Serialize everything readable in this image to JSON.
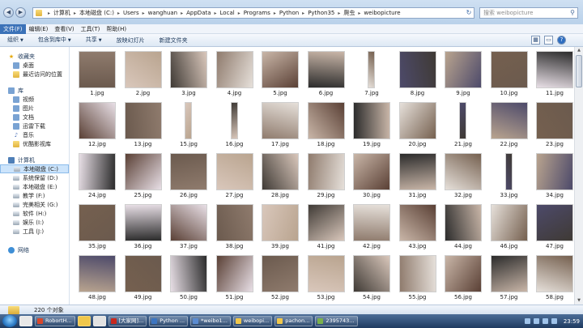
{
  "address": {
    "segments": [
      "计算机",
      "本地磁盘 (C:)",
      "Users",
      "wanghuan",
      "AppData",
      "Local",
      "Programs",
      "Python",
      "Python35",
      "爬虫",
      "weibopicture"
    ],
    "search_placeholder": "搜索 weibopicture"
  },
  "menu": [
    "文件(F)",
    "编辑(E)",
    "查看(V)",
    "工具(T)",
    "帮助(H)"
  ],
  "toolbar": [
    "组织",
    "包含到库中",
    "共享",
    "放映幻灯片",
    "新建文件夹"
  ],
  "nav": {
    "favorites": {
      "title": "收藏夹",
      "items": [
        "桌面",
        "最近访问的位置"
      ]
    },
    "library": {
      "title": "库",
      "items": [
        "视频",
        "图片",
        "文档",
        "迅雷下载",
        "音乐",
        "优酷影视库"
      ]
    },
    "computer": {
      "title": "计算机",
      "items": [
        "本地磁盘 (C:)",
        "系统保留 (D:)",
        "本地磁盘 (E:)",
        "教学 (F:)",
        "完美相关 (G:)",
        "软件 (H:)",
        "娱乐 (I:)",
        "工具 (J:)"
      ]
    },
    "network": {
      "title": "网络"
    }
  },
  "files": [
    "1.jpg",
    "2.jpg",
    "3.jpg",
    "4.jpg",
    "5.jpg",
    "6.jpg",
    "7.jpg",
    "8.jpg",
    "9.jpg",
    "10.jpg",
    "11.jpg",
    "12.jpg",
    "13.jpg",
    "15.jpg",
    "16.jpg",
    "17.jpg",
    "18.jpg",
    "19.jpg",
    "20.jpg",
    "21.jpg",
    "22.jpg",
    "23.jpg",
    "24.jpg",
    "25.jpg",
    "26.jpg",
    "27.jpg",
    "28.jpg",
    "29.jpg",
    "30.jpg",
    "31.jpg",
    "32.jpg",
    "33.jpg",
    "34.jpg",
    "35.jpg",
    "36.jpg",
    "37.jpg",
    "38.jpg",
    "39.jpg",
    "41.jpg",
    "42.jpg",
    "43.jpg",
    "44.jpg",
    "46.jpg",
    "47.jpg",
    "48.jpg",
    "49.jpg",
    "50.jpg",
    "51.jpg",
    "52.jpg",
    "53.jpg",
    "54.jpg",
    "55.jpg",
    "56.jpg",
    "57.jpg",
    "58.jpg"
  ],
  "status": {
    "count": "220 个对象"
  },
  "taskbar": {
    "tasks": [
      "RobortH...",
      "[大家网]...",
      "Python ...",
      "*weibo1...",
      "weibopi...",
      "pachon...",
      "2395743..."
    ],
    "clock": "23:59"
  }
}
